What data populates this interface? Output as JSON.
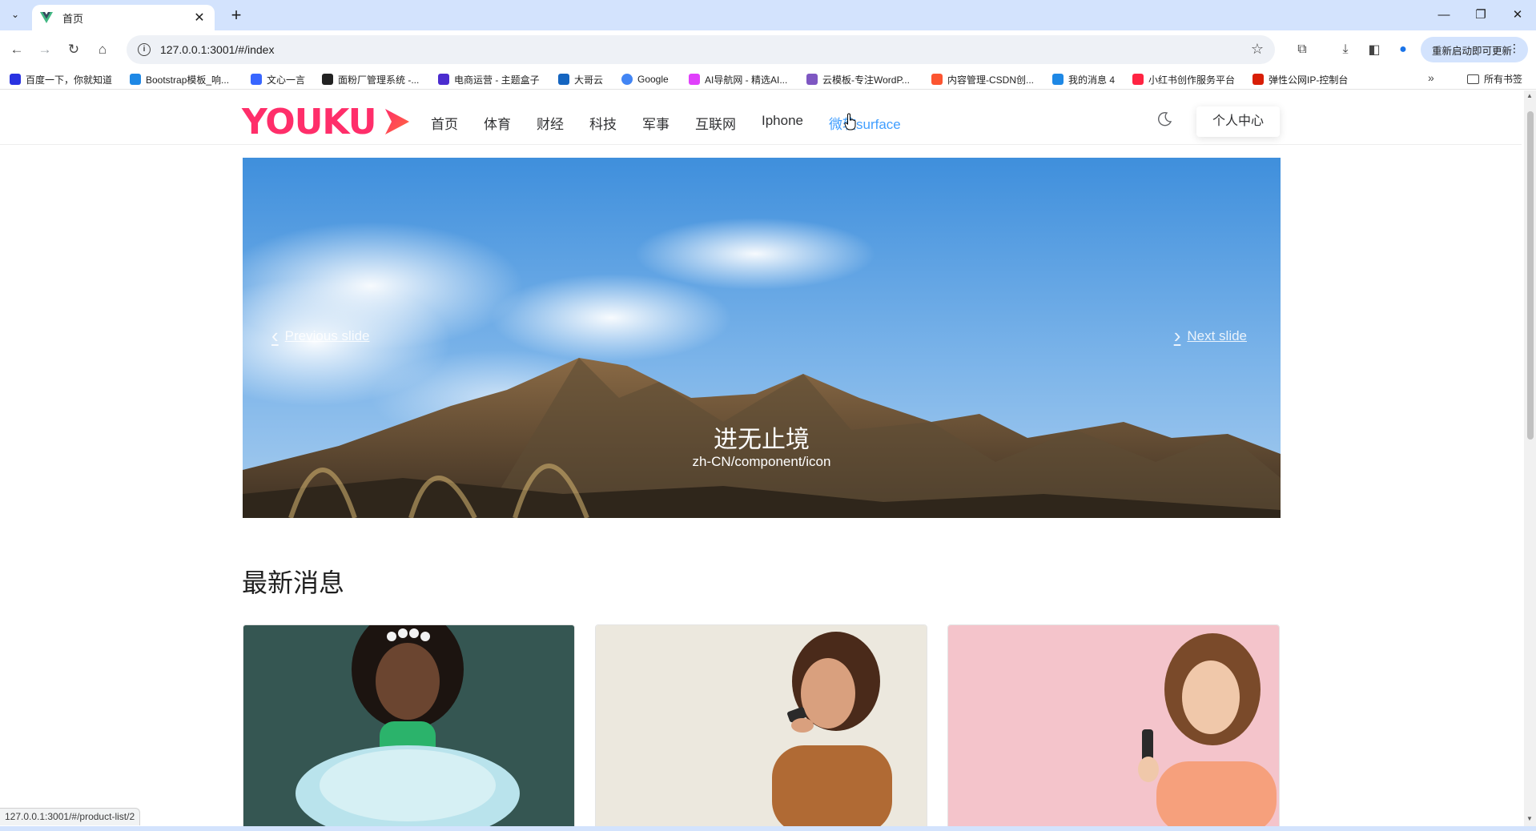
{
  "browser": {
    "tab_title": "首页",
    "url": "127.0.0.1:3001/#/index",
    "update_button": "重新启动即可更新",
    "bookmarks": [
      {
        "label": "百度一下，你就知道",
        "color": "#2932e1"
      },
      {
        "label": "Bootstrap模板_响...",
        "color": "#1e88e5"
      },
      {
        "label": "文心一言",
        "color": "#3866ff"
      },
      {
        "label": "面粉厂管理系统 -...",
        "color": "#222222"
      },
      {
        "label": "电商运营 - 主题盒子",
        "color": "#4b2ccf"
      },
      {
        "label": "大哥云",
        "color": "#1565c0"
      },
      {
        "label": "Google",
        "color": "#4285f4"
      },
      {
        "label": "AI导航网 - 精选AI...",
        "color": "#e040fb"
      },
      {
        "label": "云模板-专注WordP...",
        "color": "#7e57c2"
      },
      {
        "label": "内容管理-CSDN创...",
        "color": "#fc5531"
      },
      {
        "label": "我的消息 4",
        "color": "#1e88e5"
      },
      {
        "label": "小红书创作服务平台",
        "color": "#ff2442"
      },
      {
        "label": "弹性公网IP-控制台",
        "color": "#d81e06"
      }
    ],
    "bookmarks_folder": "所有书签",
    "status_url": "127.0.0.1:3001/#/product-list/2"
  },
  "site": {
    "logo_text": "YOUKU",
    "brand_color": "#ff2e6a",
    "nav": [
      "首页",
      "体育",
      "财经",
      "科技",
      "军事",
      "互联网",
      "Iphone",
      "微软surface"
    ],
    "profile_button": "个人中心"
  },
  "carousel": {
    "prev_label": "Previous slide",
    "next_label": "Next slide",
    "caption_title": "进无止境",
    "caption_subtitle": "zh-CN/component/icon"
  },
  "section": {
    "title": "最新消息"
  }
}
